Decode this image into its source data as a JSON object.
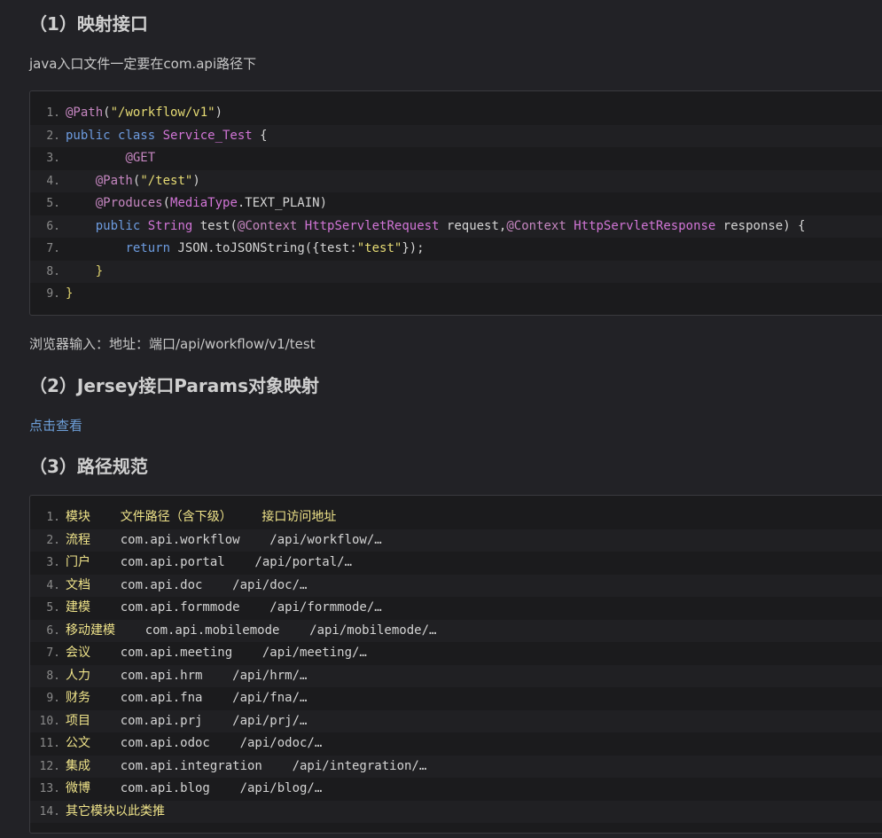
{
  "section1": {
    "heading": "（1）映射接口",
    "intro": "java入口文件一定要在com.api路径下",
    "after": "浏览器输入：地址：端口/api/workflow/v1/test"
  },
  "code1": [
    {
      "n": "1.",
      "parts": [
        {
          "c": "ann",
          "t": "@Path"
        },
        {
          "c": "pl",
          "t": "("
        },
        {
          "c": "str",
          "t": "\"/workflow/v1\""
        },
        {
          "c": "pl",
          "t": ")"
        }
      ]
    },
    {
      "n": "2.",
      "parts": [
        {
          "c": "kw",
          "t": "public class "
        },
        {
          "c": "typ",
          "t": "Service_Test"
        },
        {
          "c": "pl",
          "t": " {"
        }
      ]
    },
    {
      "n": "3.",
      "parts": [
        {
          "c": "pl",
          "t": "        "
        },
        {
          "c": "ann",
          "t": "@GET"
        }
      ]
    },
    {
      "n": "4.",
      "parts": [
        {
          "c": "pl",
          "t": "    "
        },
        {
          "c": "ann",
          "t": "@Path"
        },
        {
          "c": "pl",
          "t": "("
        },
        {
          "c": "str",
          "t": "\"/test\""
        },
        {
          "c": "pl",
          "t": ")"
        }
      ]
    },
    {
      "n": "5.",
      "parts": [
        {
          "c": "pl",
          "t": "    "
        },
        {
          "c": "ann",
          "t": "@Produces"
        },
        {
          "c": "pl",
          "t": "("
        },
        {
          "c": "typ",
          "t": "MediaType"
        },
        {
          "c": "pl",
          "t": ".TEXT_PLAIN)"
        }
      ]
    },
    {
      "n": "6.",
      "parts": [
        {
          "c": "pl",
          "t": "    "
        },
        {
          "c": "kw",
          "t": "public "
        },
        {
          "c": "typ",
          "t": "String"
        },
        {
          "c": "pl",
          "t": " test("
        },
        {
          "c": "ann",
          "t": "@Context"
        },
        {
          "c": "pl",
          "t": " "
        },
        {
          "c": "typ",
          "t": "HttpServletRequest"
        },
        {
          "c": "pl",
          "t": " request,"
        },
        {
          "c": "ann",
          "t": "@Context"
        },
        {
          "c": "pl",
          "t": " "
        },
        {
          "c": "typ",
          "t": "HttpServletResponse"
        },
        {
          "c": "pl",
          "t": " response) {"
        }
      ]
    },
    {
      "n": "7.",
      "parts": [
        {
          "c": "pl",
          "t": "        "
        },
        {
          "c": "kw",
          "t": "return "
        },
        {
          "c": "pl",
          "t": "JSON.toJSONString({test:"
        },
        {
          "c": "str",
          "t": "\"test\""
        },
        {
          "c": "pl",
          "t": "});"
        }
      ]
    },
    {
      "n": "8.",
      "parts": [
        {
          "c": "pl",
          "t": "    "
        },
        {
          "c": "yl",
          "t": "}"
        }
      ]
    },
    {
      "n": "9.",
      "parts": [
        {
          "c": "yl",
          "t": "}"
        }
      ]
    }
  ],
  "section2": {
    "heading": "（2）Jersey接口Params对象映射",
    "link": "点击查看"
  },
  "section3": {
    "heading": "（3）路径规范"
  },
  "code2": [
    {
      "n": "1.",
      "text": "模块    文件路径（含下级）    接口访问地址",
      "c": "t-yellow"
    },
    {
      "n": "2.",
      "text": "流程    com.api.workflow    /api/workflow/…",
      "c": "t-plain",
      "lead": "流程"
    },
    {
      "n": "3.",
      "text": "门户    com.api.portal    /api/portal/…",
      "c": "t-plain",
      "lead": "门户"
    },
    {
      "n": "4.",
      "text": "文档    com.api.doc    /api/doc/…",
      "c": "t-plain",
      "lead": "文档"
    },
    {
      "n": "5.",
      "text": "建模    com.api.formmode    /api/formmode/…",
      "c": "t-plain",
      "lead": "建模"
    },
    {
      "n": "6.",
      "text": "移动建模    com.api.mobilemode    /api/mobilemode/…",
      "c": "t-plain",
      "lead": "移动建模"
    },
    {
      "n": "7.",
      "text": "会议    com.api.meeting    /api/meeting/…",
      "c": "t-plain",
      "lead": "会议"
    },
    {
      "n": "8.",
      "text": "人力    com.api.hrm    /api/hrm/…",
      "c": "t-plain",
      "lead": "人力"
    },
    {
      "n": "9.",
      "text": "财务    com.api.fna    /api/fna/…",
      "c": "t-plain",
      "lead": "财务"
    },
    {
      "n": "10.",
      "text": "项目    com.api.prj    /api/prj/…",
      "c": "t-plain",
      "lead": "项目"
    },
    {
      "n": "11.",
      "text": "公文    com.api.odoc    /api/odoc/…",
      "c": "t-plain",
      "lead": "公文"
    },
    {
      "n": "12.",
      "text": "集成    com.api.integration    /api/integration/…",
      "c": "t-plain",
      "lead": "集成"
    },
    {
      "n": "13.",
      "text": "微博    com.api.blog    /api/blog/…",
      "c": "t-plain",
      "lead": "微博"
    },
    {
      "n": "14.",
      "text": "其它模块以此类推",
      "c": "t-yellow"
    }
  ]
}
